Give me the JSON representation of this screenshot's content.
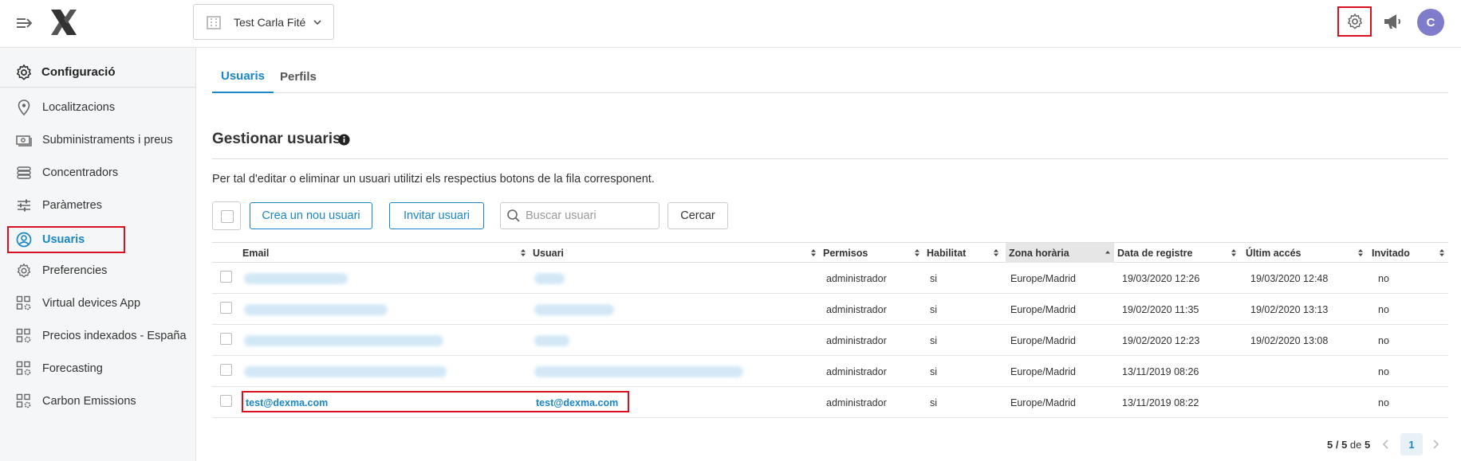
{
  "header": {
    "account_name": "Test Carla Fité",
    "avatar_initial": "C",
    "brand_color": "#1a86c8",
    "highlight_color": "#d9101f"
  },
  "sidebar": {
    "title": "Configuració",
    "items": [
      {
        "label": "Localitzacions",
        "icon": "location-pin-icon"
      },
      {
        "label": "Subministraments i preus",
        "icon": "money-icon"
      },
      {
        "label": "Concentradors",
        "icon": "gateway-icon"
      },
      {
        "label": "Paràmetres",
        "icon": "sliders-icon"
      },
      {
        "label": "Usuaris",
        "icon": "user-circle-icon",
        "active": true
      },
      {
        "label": "Preferencies",
        "icon": "gear-icon"
      },
      {
        "label": "Virtual devices App",
        "icon": "apps-gear-icon"
      },
      {
        "label": "Precios indexados - España",
        "icon": "apps-gear-icon"
      },
      {
        "label": "Forecasting",
        "icon": "apps-gear-icon"
      },
      {
        "label": "Carbon Emissions",
        "icon": "apps-gear-icon"
      }
    ]
  },
  "tabs": [
    {
      "label": "Usuaris",
      "active": true
    },
    {
      "label": "Perfils",
      "active": false
    }
  ],
  "section": {
    "title": "Gestionar usuaris",
    "description": "Per tal d'editar o eliminar un usuari utilitzi els respectius botons de la fila corresponent."
  },
  "toolbar": {
    "create_label": "Crea un nou usuari",
    "invite_label": "Invitar usuari",
    "search_placeholder": "Buscar usuari",
    "search_button": "Cercar"
  },
  "table": {
    "columns": [
      "Email",
      "Usuari",
      "Permisos",
      "Habilitat",
      "Zona horària",
      "Data de registre",
      "Últim accés",
      "Invitado"
    ],
    "sorted_column": "Zona horària",
    "rows": [
      {
        "email": "",
        "user": "",
        "permisos": "administrador",
        "habilitat": "si",
        "zona": "Europe/Madrid",
        "registre": "19/03/2020 12:26",
        "acces": "19/03/2020 12:48",
        "invitado": "no",
        "blurred": true
      },
      {
        "email": "",
        "user": "",
        "permisos": "administrador",
        "habilitat": "si",
        "zona": "Europe/Madrid",
        "registre": "19/02/2020 11:35",
        "acces": "19/02/2020 13:13",
        "invitado": "no",
        "blurred": true
      },
      {
        "email": "",
        "user": "",
        "permisos": "administrador",
        "habilitat": "si",
        "zona": "Europe/Madrid",
        "registre": "19/02/2020 12:23",
        "acces": "19/02/2020 13:08",
        "invitado": "no",
        "blurred": true
      },
      {
        "email": "",
        "user": "",
        "permisos": "administrador",
        "habilitat": "si",
        "zona": "Europe/Madrid",
        "registre": "13/11/2019 08:26",
        "acces": "",
        "invitado": "no",
        "blurred": true
      },
      {
        "email": "test@dexma.com",
        "user": "test@dexma.com",
        "permisos": "administrador",
        "habilitat": "si",
        "zona": "Europe/Madrid",
        "registre": "13/11/2019 08:22",
        "acces": "",
        "invitado": "no",
        "blurred": false
      }
    ]
  },
  "pagination": {
    "shown": "5 / 5",
    "of_label": "de",
    "total": "5",
    "current_page": "1"
  }
}
